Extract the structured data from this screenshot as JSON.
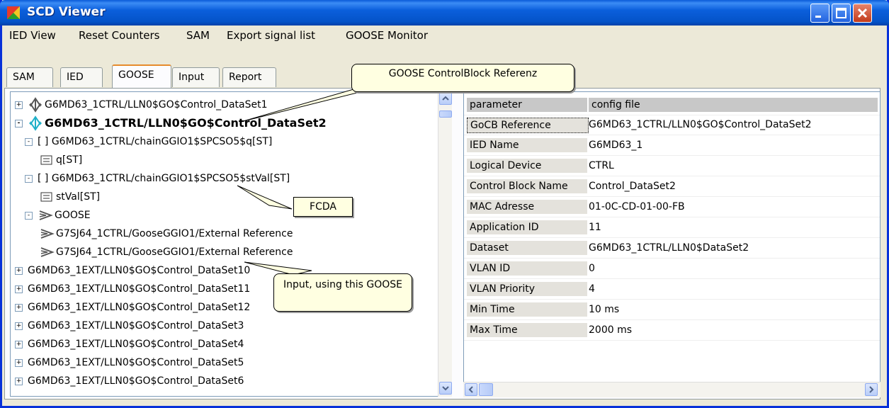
{
  "window": {
    "title": "SCD Viewer"
  },
  "menu": [
    "IED View",
    "Reset Counters",
    "SAM",
    "Export signal list",
    "GOOSE Monitor"
  ],
  "tabs": [
    "SAM",
    "IED",
    "GOOSE",
    "Input",
    "Report"
  ],
  "active_tab": "GOOSE",
  "tree": [
    {
      "text": "G6MD63_1CTRL/LLN0$GO$Control_DataSet1",
      "expander": "+",
      "icon": "goose-cb-icon"
    },
    {
      "text": "G6MD63_1CTRL/LLN0$GO$Control_DataSet2",
      "expander": "-",
      "icon": "goose-cb-selected-icon",
      "selected": true
    },
    {
      "text": "[ ] G6MD63_1CTRL/chainGGIO1$SPCSO5$q[ST]",
      "expander": "-"
    },
    {
      "text": "q[ST]",
      "icon": "attribute-icon"
    },
    {
      "text": "[ ] G6MD63_1CTRL/chainGGIO1$SPCSO5$stVal[ST]",
      "expander": "-"
    },
    {
      "text": "stVal[ST]",
      "icon": "attribute-icon"
    },
    {
      "text": "GOOSE",
      "expander": "-",
      "icon": "goose-input-icon"
    },
    {
      "text": "G7SJ64_1CTRL/GooseGGIO1/External Reference",
      "icon": "goose-input-icon"
    },
    {
      "text": "G7SJ64_1CTRL/GooseGGIO1/External Reference",
      "icon": "goose-input-icon"
    },
    {
      "text": "G6MD63_1EXT/LLN0$GO$Control_DataSet10",
      "expander": "+"
    },
    {
      "text": "G6MD63_1EXT/LLN0$GO$Control_DataSet11",
      "expander": "+"
    },
    {
      "text": "G6MD63_1EXT/LLN0$GO$Control_DataSet12",
      "expander": "+"
    },
    {
      "text": "G6MD63_1EXT/LLN0$GO$Control_DataSet3",
      "expander": "+"
    },
    {
      "text": "G6MD63_1EXT/LLN0$GO$Control_DataSet4",
      "expander": "+"
    },
    {
      "text": "G6MD63_1EXT/LLN0$GO$Control_DataSet5",
      "expander": "+"
    },
    {
      "text": "G6MD63_1EXT/LLN0$GO$Control_DataSet6",
      "expander": "+"
    }
  ],
  "grid": {
    "headers": [
      "parameter",
      "config file"
    ],
    "rows": [
      [
        "GoCB Reference",
        "G6MD63_1CTRL/LLN0$GO$Control_DataSet2"
      ],
      [
        "IED Name",
        "G6MD63_1"
      ],
      [
        "Logical Device",
        "CTRL"
      ],
      [
        "Control Block Name",
        "Control_DataSet2"
      ],
      [
        "MAC Adresse",
        "01-0C-CD-01-00-FB"
      ],
      [
        "Application ID",
        "11"
      ],
      [
        "Dataset",
        "G6MD63_1CTRL/LLN0$DataSet2"
      ],
      [
        "VLAN ID",
        "0"
      ],
      [
        "VLAN Priority",
        "4"
      ],
      [
        "Min Time",
        "10 ms"
      ],
      [
        "Max Time",
        "2000 ms"
      ]
    ]
  },
  "callouts": {
    "gocb": "GOOSE ControlBlock Referenz",
    "fcda": "FCDA",
    "input": "Input, using this GOOSE"
  }
}
